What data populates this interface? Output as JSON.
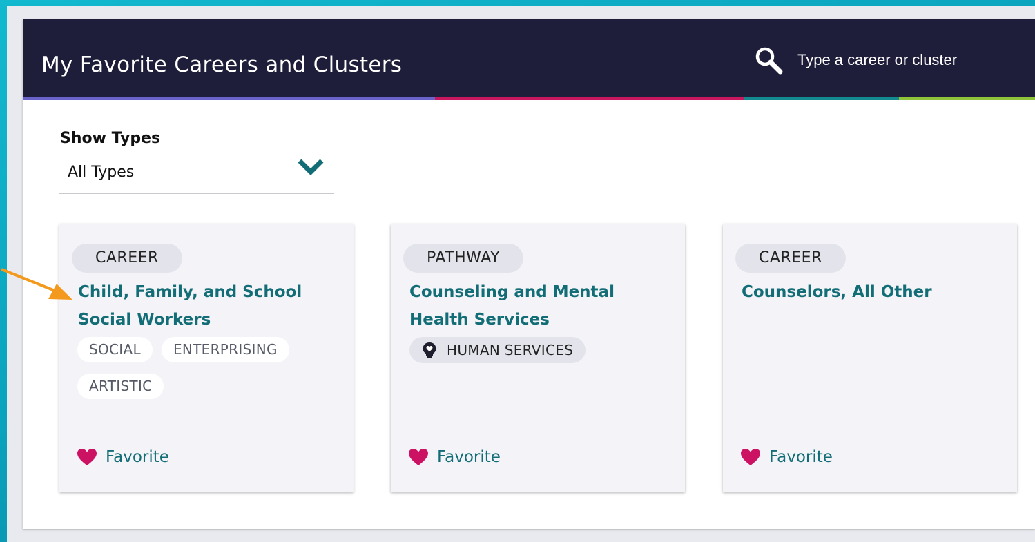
{
  "header": {
    "title": "My Favorite Careers and Clusters",
    "search_placeholder": "Type a career or cluster",
    "accent_colors": [
      "#6a63c9",
      "#c8175e",
      "#138a8f",
      "#8fc33a"
    ]
  },
  "filter": {
    "label": "Show Types",
    "selected": "All Types"
  },
  "cards": [
    {
      "type": "CAREER",
      "title": "Child, Family, and School Social Workers",
      "tags": [
        "SOCIAL",
        "ENTERPRISING",
        "ARTISTIC"
      ],
      "favorite_label": "Favorite"
    },
    {
      "type": "PATHWAY",
      "title": "Counseling and Mental Health Services",
      "cluster": "HUMAN SERVICES",
      "cluster_icon": "lightbulb-heart-icon",
      "favorite_label": "Favorite"
    },
    {
      "type": "CAREER",
      "title": "Counselors, All Other",
      "favorite_label": "Favorite"
    }
  ],
  "colors": {
    "header_bg": "#1e1e3a",
    "link": "#136d76",
    "heart": "#cc1263",
    "annotation_arrow": "#f39a1e"
  }
}
